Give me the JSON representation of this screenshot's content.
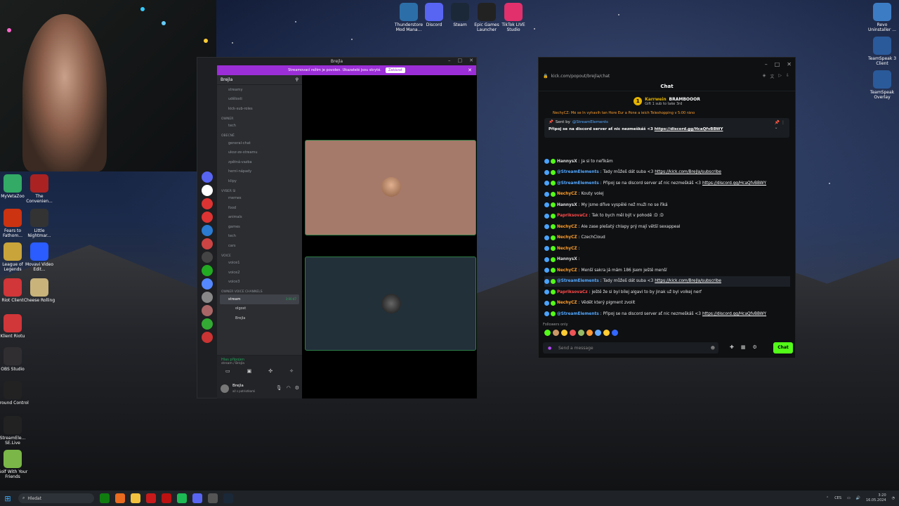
{
  "desktop": {
    "icons_top": [
      {
        "label": "Thunderstore Mod Mana...",
        "color": "#2c6fa8"
      },
      {
        "label": "Discord",
        "color": "#5865f2"
      },
      {
        "label": "Steam",
        "color": "#1b2838"
      },
      {
        "label": "Epic Games Launcher",
        "color": "#222222"
      },
      {
        "label": "TikTok LIVE Studio",
        "color": "#e1306c"
      }
    ],
    "icons_left": [
      {
        "label": "MyVetaZoo",
        "color": "#3a6"
      },
      {
        "label": "The Convenien...",
        "color": "#a22"
      },
      {
        "label": "Fears to Fathom...",
        "color": "#c31"
      },
      {
        "label": "Little Nightmar...",
        "color": "#333"
      },
      {
        "label": "League of Legends",
        "color": "#c8a43a"
      },
      {
        "label": "Movavi Video Edit...",
        "color": "#2a5cff"
      },
      {
        "label": "Riot Client",
        "color": "#d13639"
      },
      {
        "label": "Cheese Rolling",
        "color": "#c9b37a"
      },
      {
        "label": "Klient Riotu",
        "color": "#d13639"
      },
      {
        "label": "OBS Studio",
        "color": "#302e31"
      },
      {
        "label": "Ground Control",
        "color": "#222"
      },
      {
        "label": "StreamEle... SE.Live",
        "color": "#222"
      },
      {
        "label": "Golf With Your Friends",
        "color": "#7ab648"
      }
    ],
    "icons_right": [
      {
        "label": "Revo Uninstaller ...",
        "color": "#3c7cc4"
      },
      {
        "label": "TeamSpeak 3 Client",
        "color": "#2a5a9a"
      },
      {
        "label": "TeamSpeak Overlay",
        "color": "#2a5a9a"
      }
    ]
  },
  "discord": {
    "title": "Brejla",
    "banner_text": "Streamovací režim je povolen. Ukazatelé jsou skryté.",
    "banner_button": "Zakázat",
    "server_name": "Brejla",
    "channels": [
      {
        "type": "ch",
        "label": "streamy"
      },
      {
        "type": "ch",
        "label": "udělosti"
      },
      {
        "type": "ch",
        "label": "kick-sub-roles"
      },
      {
        "type": "cat",
        "label": "OWNER"
      },
      {
        "type": "ch",
        "label": "tech"
      },
      {
        "type": "cat",
        "label": "OBECNÉ"
      },
      {
        "type": "ch",
        "label": "general-chat"
      },
      {
        "type": "ch",
        "label": "ukoz-ze-streamu"
      },
      {
        "type": "ch",
        "label": "zpětná-vazba"
      },
      {
        "type": "ch",
        "label": "herní-nápady"
      },
      {
        "type": "ch",
        "label": "klipy"
      },
      {
        "type": "cat",
        "label": "VYBER SI"
      },
      {
        "type": "ch",
        "label": "memes"
      },
      {
        "type": "ch",
        "label": "food"
      },
      {
        "type": "ch",
        "label": "animals"
      },
      {
        "type": "ch",
        "label": "games"
      },
      {
        "type": "ch",
        "label": "tech"
      },
      {
        "type": "ch",
        "label": "cars"
      },
      {
        "type": "cat",
        "label": "VOICE"
      },
      {
        "type": "ch",
        "label": "voice1"
      },
      {
        "type": "ch",
        "label": "voice2"
      },
      {
        "type": "ch",
        "label": "voice3"
      },
      {
        "type": "cat",
        "label": "OWNER VOICE CHANNELS"
      },
      {
        "type": "active",
        "label": "stream",
        "extra": "3:00:47"
      },
      {
        "type": "member",
        "label": "olgost"
      },
      {
        "type": "member",
        "label": "Brejla"
      }
    ],
    "voice_status": "Hlas připojen",
    "voice_sub": "stream / Brejla",
    "user_name": "Brejla",
    "user_status": "až s patriotkami"
  },
  "kick": {
    "url": "kick.com/popout/brejla/chat",
    "chat_title": "Chat",
    "gift_user": "Karrwein",
    "gift_target": "BRAMBOOOR",
    "gift_text": "Gift 1 sub to take 3rd",
    "partial_msg": "NechyCZ: Mé se In vyhavíh tan Hore Eur a Pone a ieich Teleshopping v 5:00 ráno",
    "pinned_by": "Sent by",
    "pinned_user": "@StreamElements",
    "pinned_text": "Připoj se na discord server ať nic nezmeškáš <3",
    "pinned_link": "https://discord.gg/HcaQfvBBWY",
    "messages": [
      {
        "user": "HannysX",
        "color": "#dddddd",
        "text": "Ja si to neříkám",
        "link": ""
      },
      {
        "user": "@StreamElements",
        "color": "#53a7ff",
        "text": "Tady můžeš dát suba <3",
        "link": "https://kick.com/Brejla/subscribe"
      },
      {
        "user": "@StreamElements",
        "color": "#53a7ff",
        "text": "Připoj se na discord server ať nic nezmeškáš <3",
        "link": "https://discord.gg/HcaQfvBBWY"
      },
      {
        "user": "NechyCZ",
        "color": "#ff9e2c",
        "text": "Kouty volej",
        "link": ""
      },
      {
        "user": "HannysX",
        "color": "#dddddd",
        "text": "My jsme dříve vyspělé než muži no se říká",
        "link": ""
      },
      {
        "user": "PapriksovaCz",
        "color": "#ff4a4a",
        "text": "Tak to bych měl být v pohodě :D :D",
        "link": ""
      },
      {
        "user": "NechyCZ",
        "color": "#ff9e2c",
        "text": "Ale zase plešatý chlapy prý mají větší sexappeal",
        "link": ""
      },
      {
        "user": "NechyCZ",
        "color": "#ff9e2c",
        "text": "CzechCloud",
        "link": ""
      },
      {
        "user": "NechyCZ",
        "color": "#ff9e2c",
        "text": "",
        "link": ""
      },
      {
        "user": "HannysX",
        "color": "#dddddd",
        "text": "",
        "link": ""
      },
      {
        "user": "NechyCZ",
        "color": "#ff9e2c",
        "text": "Menší sakra já mám 186 jsem ještě menší",
        "link": ""
      },
      {
        "user": "@StreamElements",
        "color": "#53a7ff",
        "text": "Tady můžeš dát suba <3",
        "link": "https://kick.com/Brejla/subscribe"
      },
      {
        "user": "PapriksovaCz",
        "color": "#ff4a4a",
        "text": "ještě že si byl bílej algavi to by jinak už byl volkej nerf",
        "link": ""
      },
      {
        "user": "NechyCZ",
        "color": "#ff9e2c",
        "text": "Vědět který pigment zvolit",
        "link": ""
      },
      {
        "user": "@StreamElements",
        "color": "#53a7ff",
        "text": "Připoj se na discord server ať nic nezmeškáš <3",
        "link": "https://discord.gg/HcaQfvBBWY"
      }
    ],
    "followers_only": "Followers only",
    "send_placeholder": "Send a message",
    "chat_button": "Chat",
    "accent": "#53fc18"
  },
  "taskbar": {
    "search": "Hledat",
    "lang": "CES",
    "time": "3:20",
    "date": "16.05.2024"
  }
}
